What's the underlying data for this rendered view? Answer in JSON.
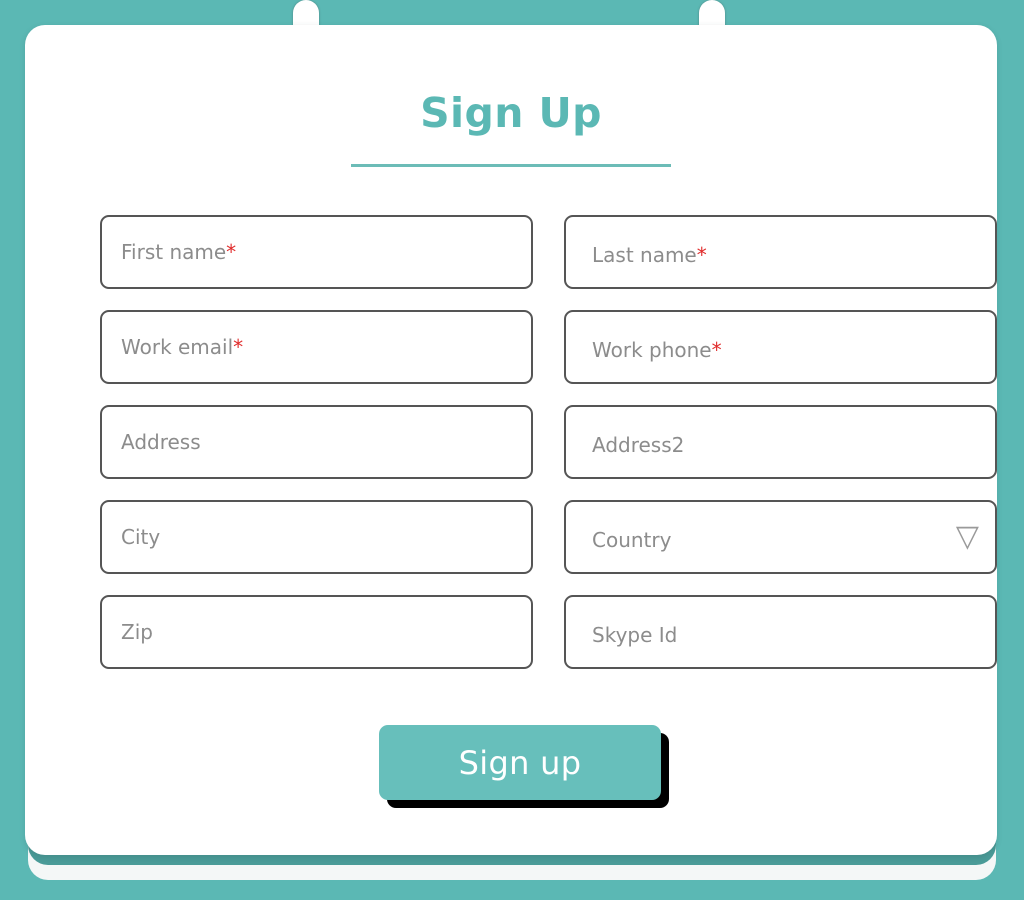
{
  "theme": {
    "background_color": "#5bb8b4",
    "accent_color": "#5bb8b4",
    "card_color": "#ffffff",
    "border_color": "#555555",
    "placeholder_color": "#8c8c8c",
    "required_marker_color": "#e02b2b",
    "button_color": "#67bfbb",
    "button_shadow_color": "#000000"
  },
  "header": {
    "title": "Sign Up"
  },
  "form": {
    "required_marker": "*",
    "fields": [
      {
        "name": "first-name",
        "placeholder": "First name",
        "required": true,
        "type": "text"
      },
      {
        "name": "last-name",
        "placeholder": "Last name",
        "required": true,
        "type": "text"
      },
      {
        "name": "work-email",
        "placeholder": "Work email",
        "required": true,
        "type": "email"
      },
      {
        "name": "work-phone",
        "placeholder": "Work phone",
        "required": true,
        "type": "tel"
      },
      {
        "name": "address",
        "placeholder": "Address",
        "required": false,
        "type": "text"
      },
      {
        "name": "address2",
        "placeholder": "Address2",
        "required": false,
        "type": "text"
      },
      {
        "name": "city",
        "placeholder": "City",
        "required": false,
        "type": "text"
      },
      {
        "name": "country",
        "placeholder": "Country",
        "required": false,
        "type": "select"
      },
      {
        "name": "zip",
        "placeholder": "Zip",
        "required": false,
        "type": "text"
      },
      {
        "name": "skype-id",
        "placeholder": "Skype Id",
        "required": false,
        "type": "text"
      }
    ]
  },
  "submit": {
    "label": "Sign up"
  },
  "icons": {
    "dropdown_arrow": "▽"
  }
}
